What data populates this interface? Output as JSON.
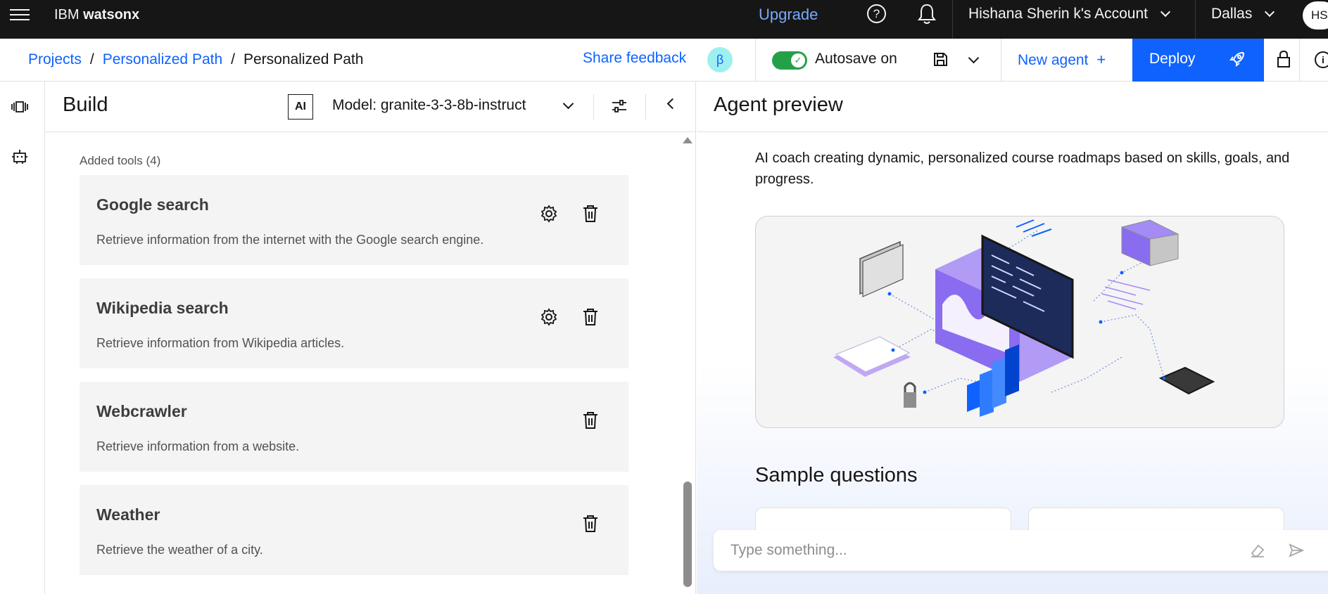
{
  "topbar": {
    "brand_prefix": "IBM",
    "brand_name": "watsonx",
    "upgrade_label": "Upgrade",
    "help_glyph": "?",
    "account_label": "Hishana Sherin k's Account",
    "region_label": "Dallas",
    "avatar_initials": "HS"
  },
  "subheader": {
    "breadcrumb": [
      "Projects",
      "Personalized Path",
      "Personalized Path"
    ],
    "share_feedback_label": "Share feedback",
    "beta_label": "β",
    "autosave_label": "Autosave on",
    "autosave_on": true,
    "new_agent_label": "New agent",
    "deploy_label": "Deploy",
    "info_glyph": "i"
  },
  "build": {
    "title": "Build",
    "ai_badge": "AI",
    "model_label": "Model: granite-3-3-8b-instruct",
    "tools_label": "Added tools (4)",
    "tools": [
      {
        "name": "Google search",
        "description": "Retrieve information from the internet with the Google search engine.",
        "configurable": true
      },
      {
        "name": "Wikipedia search",
        "description": "Retrieve information from Wikipedia articles.",
        "configurable": true
      },
      {
        "name": "Webcrawler",
        "description": "Retrieve information from a website.",
        "configurable": false
      },
      {
        "name": "Weather",
        "description": "Retrieve the weather of a city.",
        "configurable": false
      }
    ]
  },
  "preview": {
    "title": "Agent preview",
    "description": "AI coach creating dynamic, personalized course roadmaps based on skills, goals, and progress.",
    "sample_questions_title": "Sample questions",
    "input_placeholder": "Type something..."
  },
  "colors": {
    "topbar_bg": "#161616",
    "accent_blue": "#0f62fe",
    "upgrade_link": "#78a9ff",
    "toggle_green": "#24a148",
    "tool_card_bg": "#f4f4f4",
    "beta_bg": "#9ef0f0"
  },
  "icons": {
    "menu": "hamburger-menu-icon",
    "help": "help-icon",
    "notifications": "bell-icon",
    "save": "save-icon",
    "deploy": "rocket-icon",
    "lock": "lock-icon",
    "settings": "gear-icon",
    "delete": "trash-icon",
    "tune": "sliders-icon",
    "erase": "eraser-icon",
    "send": "send-icon"
  }
}
